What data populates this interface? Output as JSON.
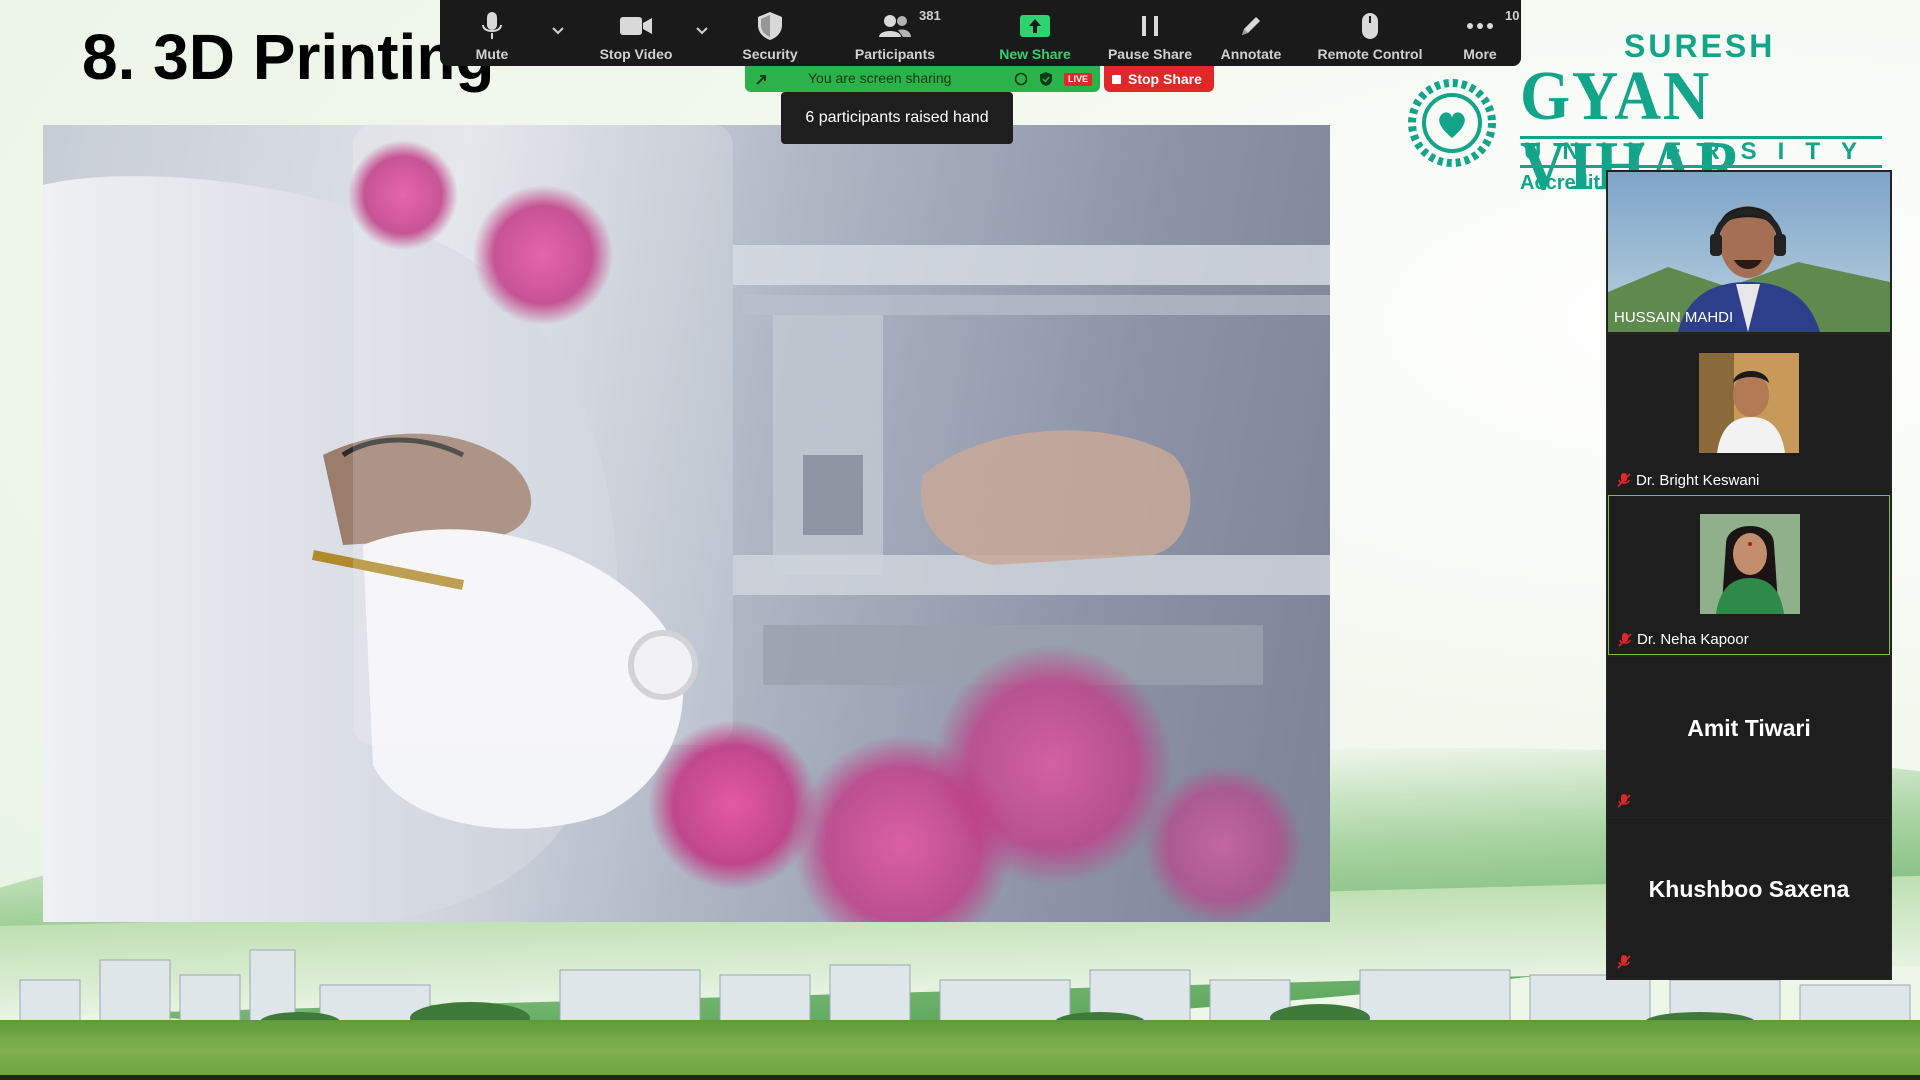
{
  "slide": {
    "title": "8. 3D Printing",
    "logo": {
      "line1": "SURESH",
      "line2": "GYAN VIHAR",
      "line3": "UNIVERSITY",
      "line4": "Accredit"
    }
  },
  "toolbar": {
    "items": [
      {
        "label": "Mute",
        "icon": "microphone-icon"
      },
      {
        "label": "Stop Video",
        "icon": "video-camera-icon"
      },
      {
        "label": "Security",
        "icon": "shield-icon"
      },
      {
        "label": "Participants",
        "icon": "participants-icon",
        "count": "381"
      },
      {
        "label": "New Share",
        "icon": "share-up-arrow-icon"
      },
      {
        "label": "Pause Share",
        "icon": "pause-icon"
      },
      {
        "label": "Annotate",
        "icon": "pencil-icon"
      },
      {
        "label": "Remote Control",
        "icon": "mouse-icon"
      },
      {
        "label": "More",
        "icon": "ellipsis-icon",
        "badge": "10"
      }
    ],
    "accent_green": "#2dd36f"
  },
  "sharing": {
    "banner_text": "You are screen sharing",
    "live_badge": "LIVE",
    "stop_label": "Stop Share",
    "tooltip": "6 participants raised hand"
  },
  "participants": [
    {
      "name": "HUSSAIN MAHDI",
      "video": true,
      "muted": false
    },
    {
      "name": "Dr. Bright Keswani",
      "video": true,
      "muted": true
    },
    {
      "name": "Dr. Neha Kapoor",
      "video": true,
      "muted": true,
      "active": true
    },
    {
      "name": "Amit Tiwari",
      "video": false,
      "muted": true
    },
    {
      "name": "Khushboo Saxena",
      "video": false,
      "muted": true
    }
  ],
  "colors": {
    "brand_teal": "#12a58a",
    "stop_red": "#e02828",
    "share_green": "#2cb24a"
  }
}
